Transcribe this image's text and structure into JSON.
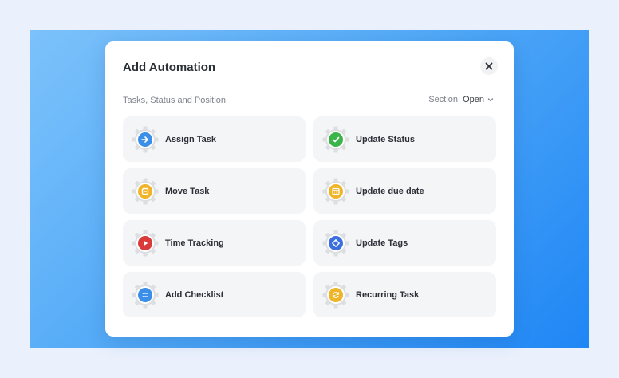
{
  "modal": {
    "title": "Add Automation",
    "section_label": "Tasks, Status and Position",
    "section_prefix": "Section:",
    "section_value": "Open"
  },
  "automations": [
    {
      "label": "Assign Task",
      "icon": "arrow-right-icon",
      "color": "#3b8fe8"
    },
    {
      "label": "Update Status",
      "icon": "check-icon",
      "color": "#3bb54a"
    },
    {
      "label": "Move Task",
      "icon": "move-task-icon",
      "color": "#f0b429"
    },
    {
      "label": "Update due date",
      "icon": "calendar-icon",
      "color": "#f0b429"
    },
    {
      "label": "Time Tracking",
      "icon": "play-icon",
      "color": "#d93a3a"
    },
    {
      "label": "Update Tags",
      "icon": "tag-icon",
      "color": "#3b6fe0"
    },
    {
      "label": "Add Checklist",
      "icon": "checklist-icon",
      "color": "#3b8fe8"
    },
    {
      "label": "Recurring Task",
      "icon": "refresh-icon",
      "color": "#f0b429"
    }
  ],
  "colors": {
    "backdrop_start": "#7cc2fb",
    "backdrop_end": "#1f86f5",
    "card_bg": "#f4f5f7",
    "gear": "#dcdee2"
  }
}
